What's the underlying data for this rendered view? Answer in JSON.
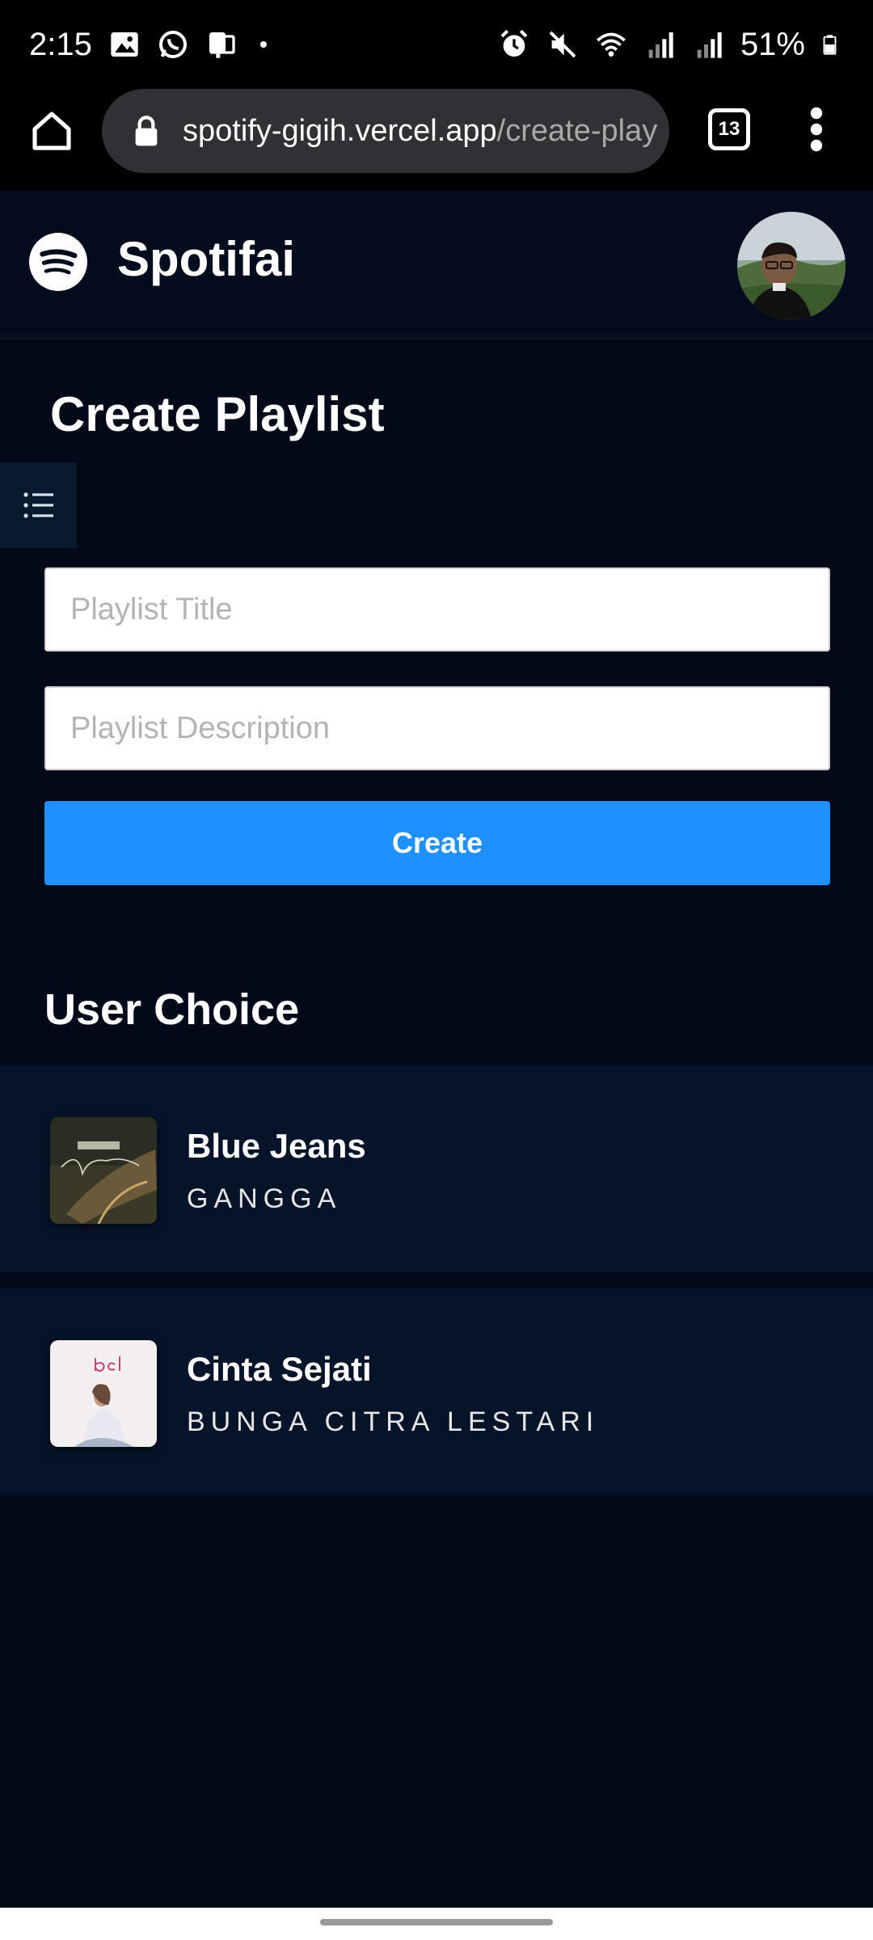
{
  "status_bar": {
    "time": "2:15",
    "battery": "51%"
  },
  "browser": {
    "url_host": "spotify-gigih.vercel.app",
    "url_path": "/create-play",
    "tab_count": "13"
  },
  "header": {
    "brand": "Spotifai"
  },
  "page": {
    "title": "Create Playlist"
  },
  "form": {
    "title_placeholder": "Playlist Title",
    "title_value": "",
    "description_placeholder": "Playlist Description",
    "description_value": "",
    "create_label": "Create"
  },
  "user_choice": {
    "heading": "User Choice",
    "tracks": [
      {
        "title": "Blue Jeans",
        "artist": "GANGGA"
      },
      {
        "title": "Cinta Sejati",
        "artist": "BUNGA CITRA LESTARI"
      }
    ]
  },
  "colors": {
    "background": "#020a1a",
    "accent": "#1e90ff",
    "row_background": "#06142a"
  },
  "icons": {
    "home": "home-icon",
    "lock": "lock-icon",
    "menu": "more-vert-icon",
    "logo": "spotify-logo-icon",
    "sidebar": "list-icon"
  }
}
